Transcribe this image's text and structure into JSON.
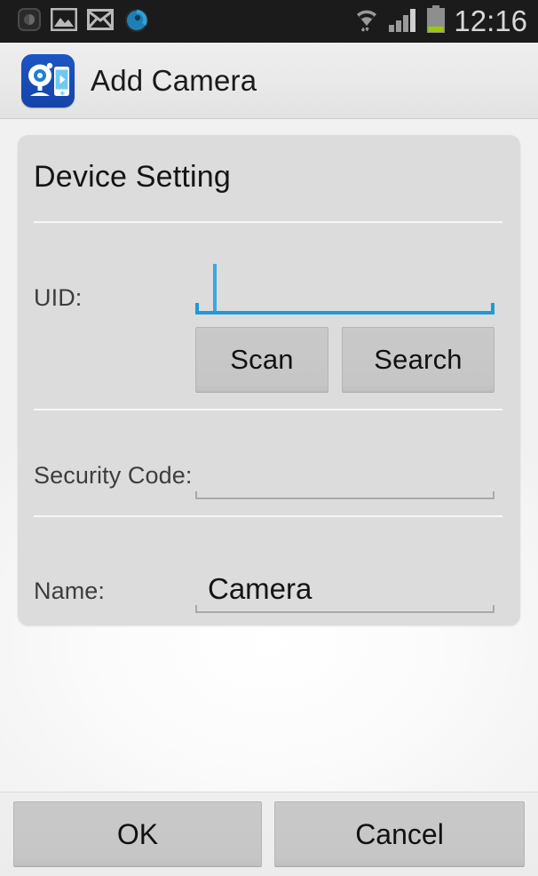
{
  "statusbar": {
    "clock": "12:16",
    "notification_icons": [
      {
        "name": "app-badge-icon",
        "label": "app"
      },
      {
        "name": "gallery-image-icon",
        "label": "gallery"
      },
      {
        "name": "mail-envelope-icon",
        "label": "mail"
      },
      {
        "name": "blue-circle-app-icon",
        "label": "media"
      }
    ],
    "system_icons": [
      {
        "name": "wifi-icon",
        "label": "wifi"
      },
      {
        "name": "cell-signal-icon",
        "label": "signal"
      },
      {
        "name": "battery-icon",
        "label": "battery"
      }
    ],
    "colors": {
      "background": "#1b1b1b",
      "text": "#d8d8d8",
      "battery_fill": "#99cc00"
    }
  },
  "actionbar": {
    "title": "Add Camera",
    "app_icon": "camera-phone-app-icon",
    "icon_color": "#1543a8"
  },
  "card": {
    "title": "Device Setting",
    "fields": [
      {
        "label": "UID:",
        "value": "",
        "focused": true,
        "accent": "#1e9ad6"
      },
      {
        "label": "Security Code:",
        "value": "",
        "focused": false
      },
      {
        "label": "Name:",
        "value": "Camera",
        "focused": false
      }
    ],
    "buttons": [
      {
        "label": "Scan"
      },
      {
        "label": "Search"
      }
    ]
  },
  "bottombar": {
    "buttons": [
      {
        "label": "OK"
      },
      {
        "label": "Cancel"
      }
    ]
  }
}
